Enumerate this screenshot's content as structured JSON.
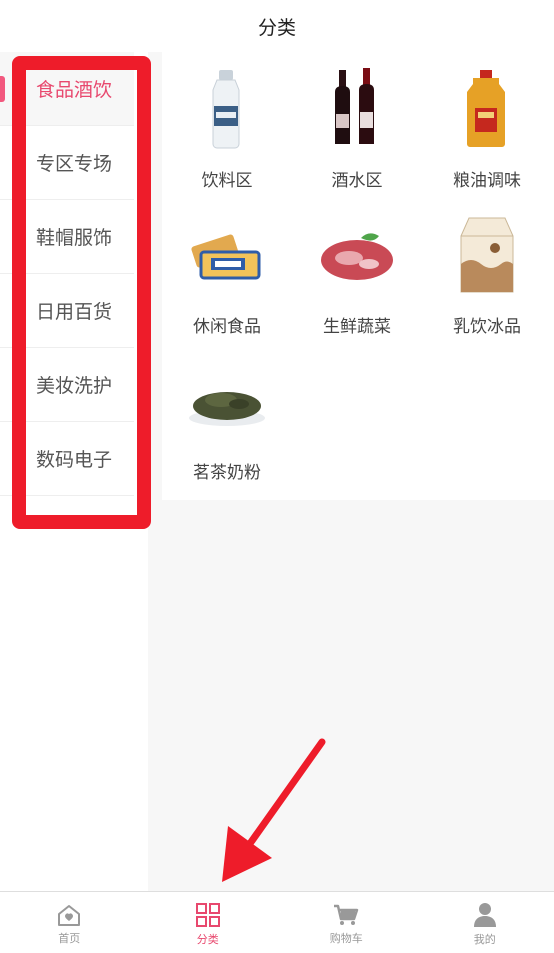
{
  "header": {
    "title": "分类"
  },
  "sidebar": {
    "items": [
      {
        "label": "食品酒饮",
        "active": true
      },
      {
        "label": "专区专场"
      },
      {
        "label": "鞋帽服饰"
      },
      {
        "label": "日用百货"
      },
      {
        "label": "美妆洗护"
      },
      {
        "label": "数码电子"
      }
    ]
  },
  "content": {
    "items": [
      {
        "label": "饮料区",
        "icon": "water-bottle-icon"
      },
      {
        "label": "酒水区",
        "icon": "wine-bottles-icon"
      },
      {
        "label": "粮油调味",
        "icon": "oil-jug-icon"
      },
      {
        "label": "休闲食品",
        "icon": "biscuit-snack-icon"
      },
      {
        "label": "生鲜蔬菜",
        "icon": "raw-meat-icon"
      },
      {
        "label": "乳饮冰品",
        "icon": "milk-carton-icon"
      },
      {
        "label": "茗茶奶粉",
        "icon": "tea-leaves-icon"
      }
    ]
  },
  "tabbar": {
    "items": [
      {
        "label": "首页",
        "icon": "home-icon"
      },
      {
        "label": "分类",
        "icon": "category-grid-icon",
        "active": true
      },
      {
        "label": "购物车",
        "icon": "cart-icon"
      },
      {
        "label": "我的",
        "icon": "user-icon"
      }
    ]
  },
  "colors": {
    "accent": "#e8486e",
    "annotation": "#ee1c2a"
  }
}
